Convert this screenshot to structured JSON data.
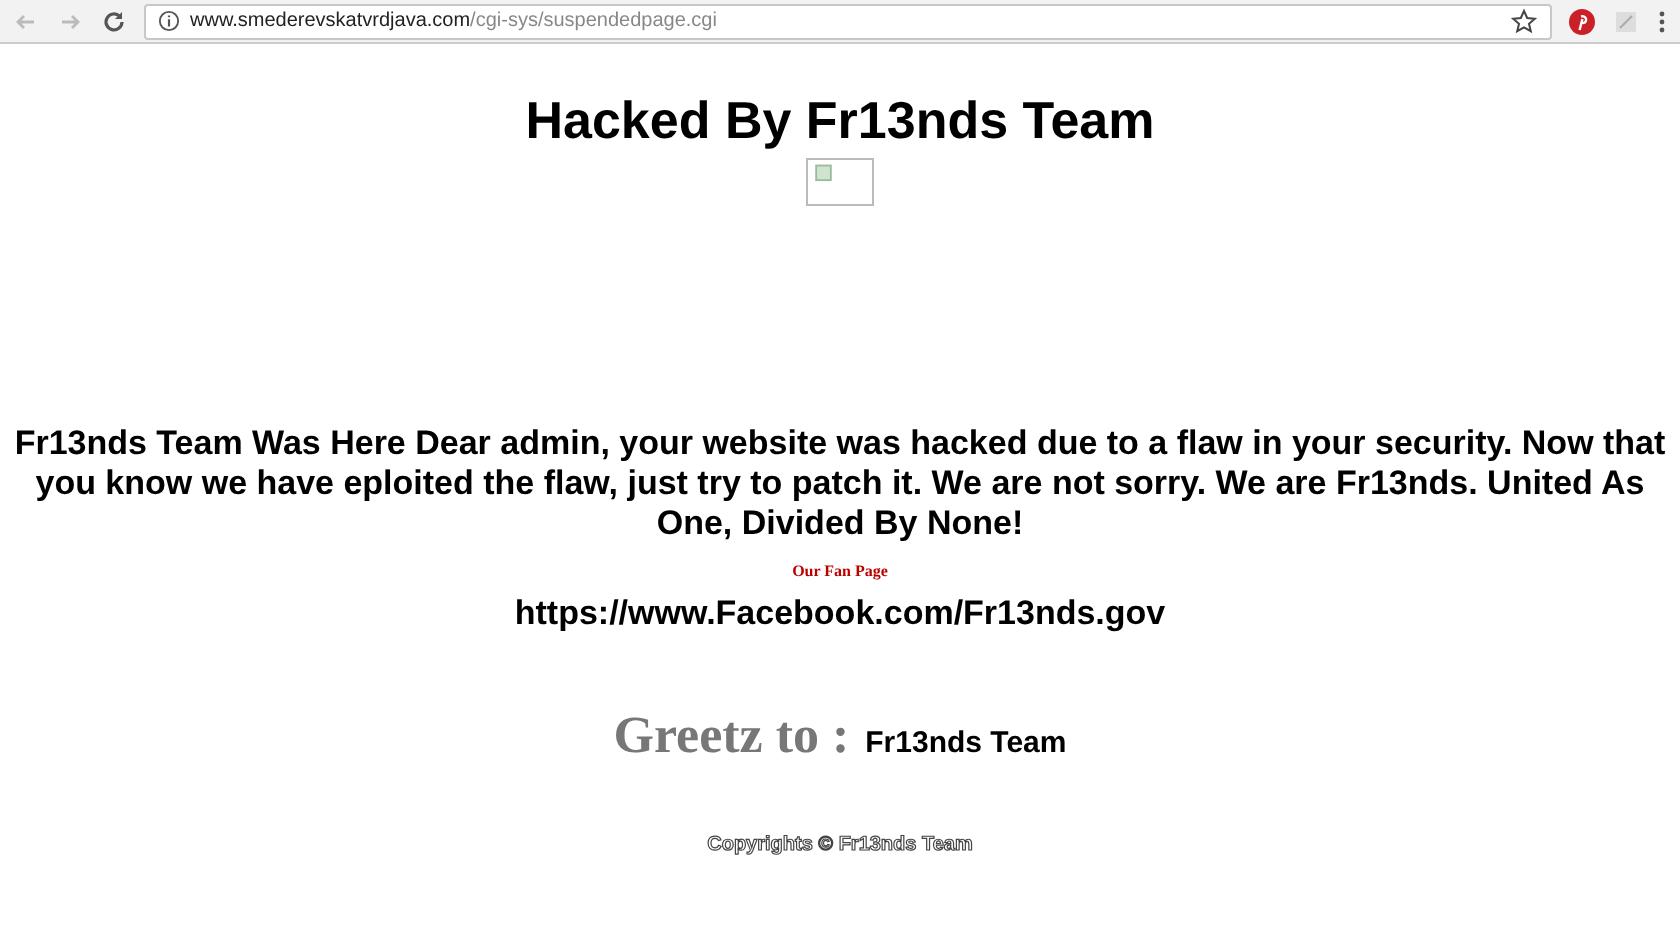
{
  "browser": {
    "url_host": "www.smederevskatvrdjava.com",
    "url_path": "/cgi-sys/suspendedpage.cgi"
  },
  "page": {
    "title": "Hacked By Fr13nds Team",
    "message": "Fr13nds Team Was Here Dear admin, your website was hacked due to a flaw in your security. Now that you know we have eploited the flaw, just try to patch it. We are not sorry. We are Fr13nds. United As One, Divided By None!",
    "fan_page_label": "Our Fan Page",
    "fan_page_url": "https://www.Facebook.com/Fr13nds.gov",
    "greetz_label": "Greetz to :",
    "greetz_name": "Fr13nds Team",
    "copyright": "Copyrights © Fr13nds Team"
  }
}
